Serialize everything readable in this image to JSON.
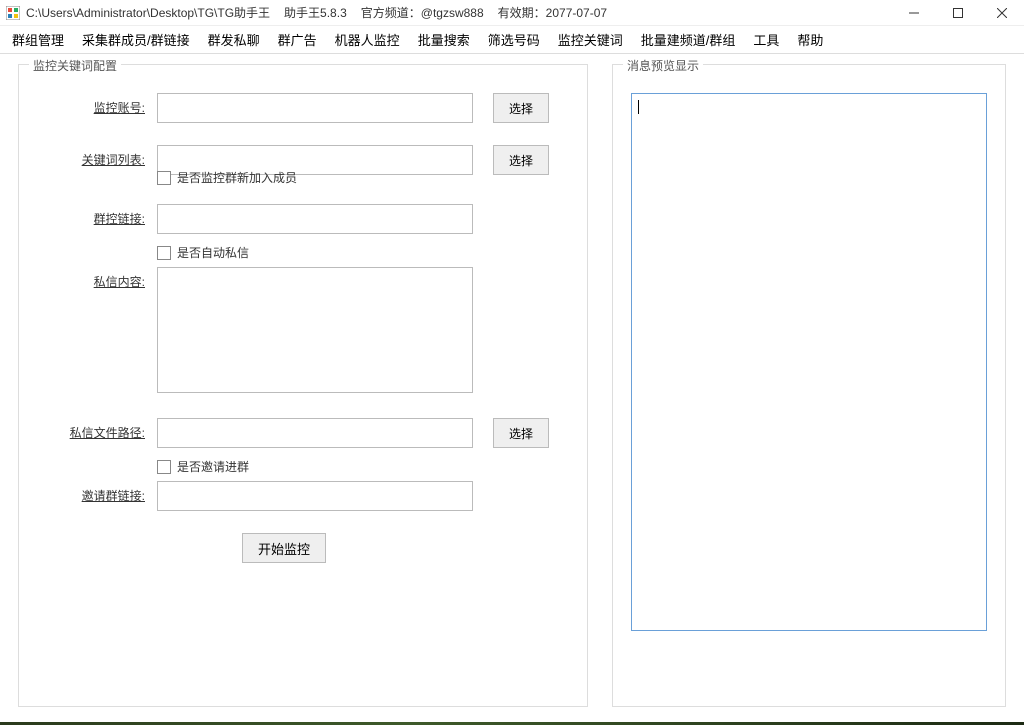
{
  "titlebar": {
    "path": "C:\\Users\\Administrator\\Desktop\\TG\\TG助手王",
    "app": "助手王5.8.3",
    "channel_label": "官方频道：",
    "channel": "@tgzsw888",
    "expiry_label": "有效期：",
    "expiry": "2077-07-07"
  },
  "menu": {
    "items": [
      "群组管理",
      "采集群成员/群链接",
      "群发私聊",
      "群广告",
      "机器人监控",
      "批量搜索",
      "筛选号码",
      "监控关键词",
      "批量建频道/群组",
      "工具",
      "帮助"
    ]
  },
  "left_panel": {
    "legend": "监控关键词配置",
    "labels": {
      "account": "监控账号:",
      "keywords": "关键词列表:",
      "group_link": "群控链接:",
      "dm_content": "私信内容:",
      "dm_file": "私信文件路径:",
      "invite_link": "邀请群链接:"
    },
    "values": {
      "account": "",
      "keywords": "",
      "group_link": "",
      "dm_content": "",
      "dm_file": "",
      "invite_link": ""
    },
    "checks": {
      "monitor_new_member": "是否监控群新加入成员",
      "auto_dm": "是否自动私信",
      "invite_to_group": "是否邀请进群"
    },
    "buttons": {
      "select": "选择",
      "start": "开始监控"
    }
  },
  "right_panel": {
    "legend": "消息预览显示",
    "content": ""
  }
}
